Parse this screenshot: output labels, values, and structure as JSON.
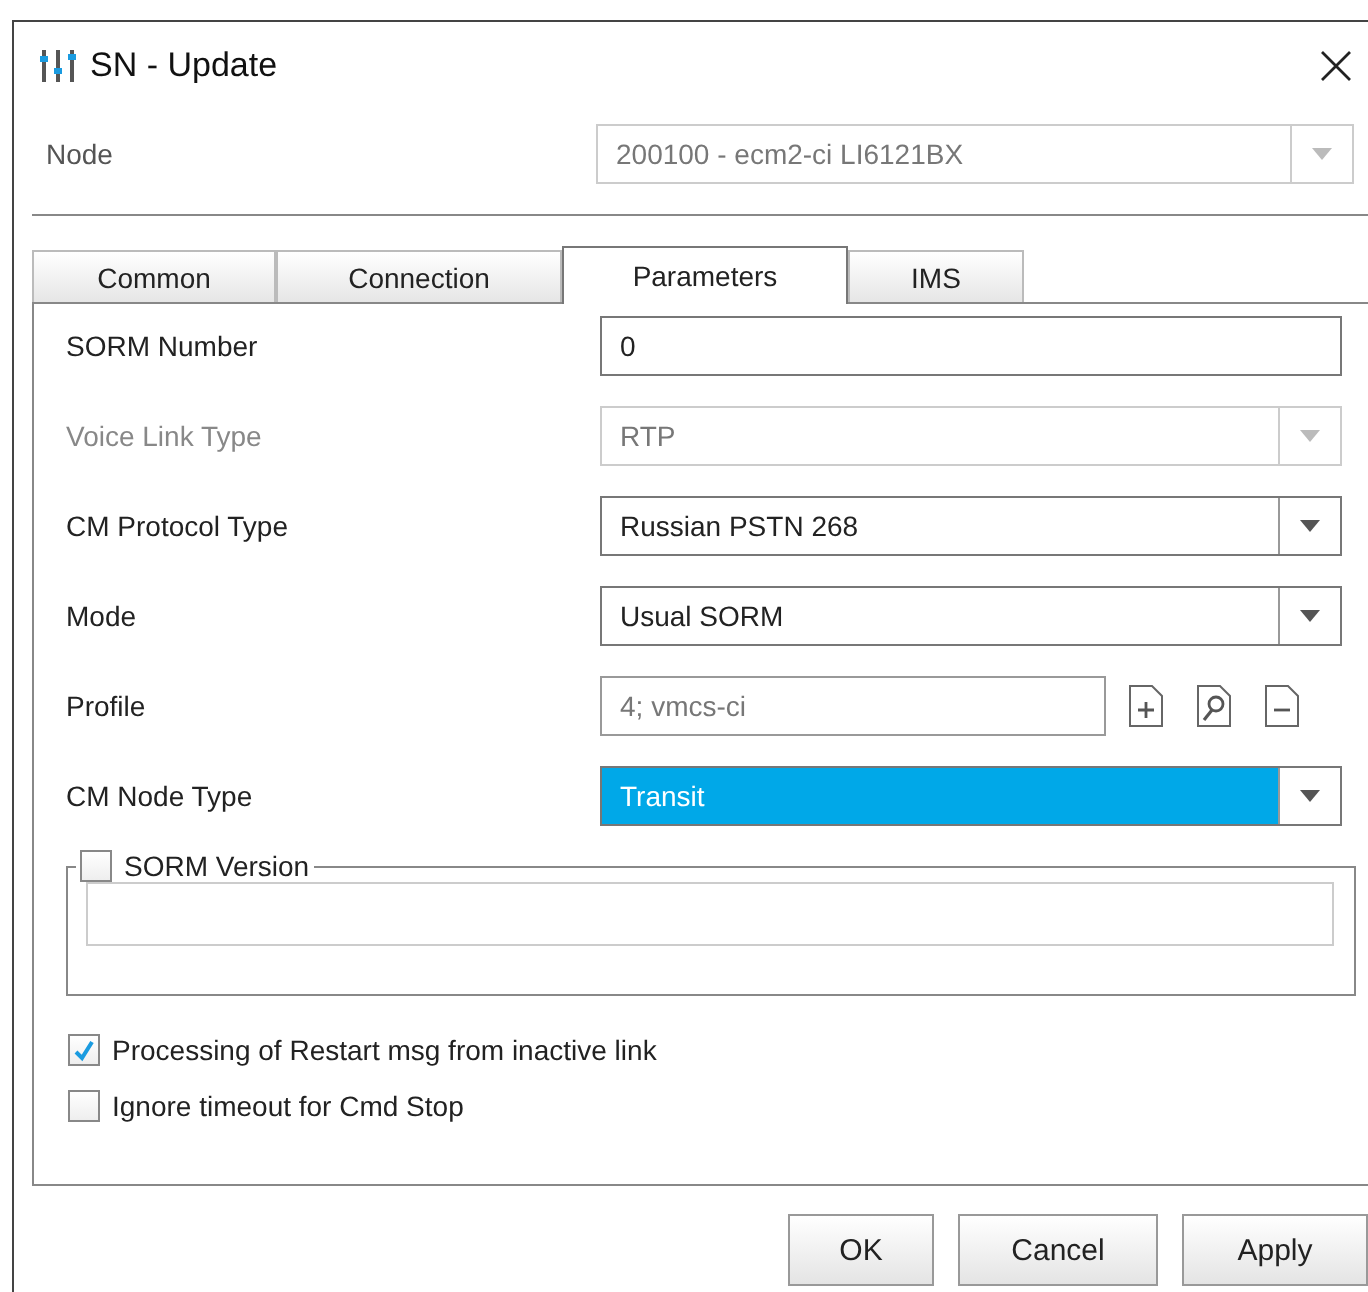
{
  "window": {
    "title": "SN - Update"
  },
  "node": {
    "label": "Node",
    "value": "200100 - ecm2-ci LI6121BX",
    "disabled": true
  },
  "tabs": [
    {
      "label": "Common",
      "selected": false
    },
    {
      "label": "Connection",
      "selected": false
    },
    {
      "label": "Parameters",
      "selected": true
    },
    {
      "label": "IMS",
      "selected": false
    }
  ],
  "fields": [
    {
      "kind": "text",
      "label": "SORM Number",
      "value": "0",
      "disabled": false,
      "focused": false
    },
    {
      "kind": "combo",
      "label": "Voice Link Type",
      "value": "RTP",
      "disabled": true,
      "focused": false
    },
    {
      "kind": "combo",
      "label": "CM Protocol Type",
      "value": "Russian PSTN 268",
      "disabled": false,
      "focused": false
    },
    {
      "kind": "combo",
      "label": "Mode",
      "value": "Usual SORM",
      "disabled": false,
      "focused": false
    },
    {
      "kind": "lookup",
      "label": "Profile",
      "value": "4; vmcs-ci",
      "disabled": true,
      "focused": false
    },
    {
      "kind": "combo",
      "label": "CM Node Type",
      "value": "Transit",
      "disabled": false,
      "focused": true
    }
  ],
  "version_group": {
    "label": "SORM Version",
    "checked": false
  },
  "checkboxes": [
    {
      "label": "Processing of Restart msg from inactive link",
      "checked": true
    },
    {
      "label": "Ignore timeout for Cmd Stop",
      "checked": false
    }
  ],
  "buttons": [
    "OK",
    "Cancel",
    "Apply"
  ]
}
